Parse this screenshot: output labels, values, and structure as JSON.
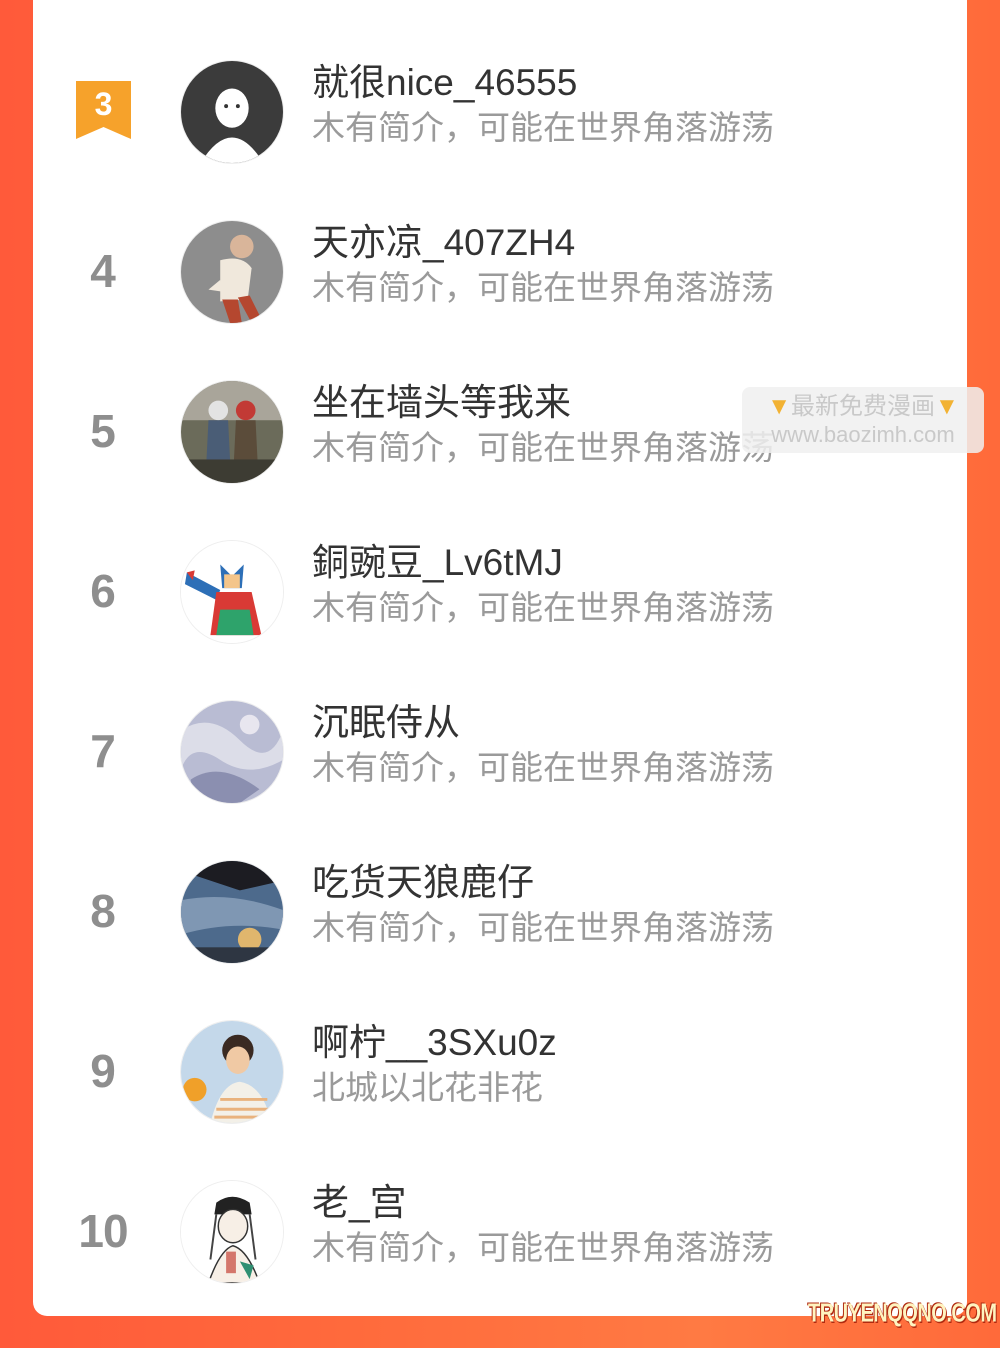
{
  "list": [
    {
      "rank": "3",
      "name": "就很nice_46555",
      "bio": "木有简介，可能在世界角落游荡",
      "badge": true
    },
    {
      "rank": "4",
      "name": "天亦凉_407ZH4",
      "bio": "木有简介，可能在世界角落游荡"
    },
    {
      "rank": "5",
      "name": "坐在墙头等我来",
      "bio": "木有简介，可能在世界角落游荡"
    },
    {
      "rank": "6",
      "name": "銅豌豆_Lv6tMJ",
      "bio": "木有简介，可能在世界角落游荡"
    },
    {
      "rank": "7",
      "name": "沉眠侍从",
      "bio": "木有简介，可能在世界角落游荡"
    },
    {
      "rank": "8",
      "name": "吃货天狼鹿仔",
      "bio": "木有简介，可能在世界角落游荡"
    },
    {
      "rank": "9",
      "name": "啊柠__3SXu0z",
      "bio": "北城以北花非花"
    },
    {
      "rank": "10",
      "name": "老_宫",
      "bio": "木有简介，可能在世界角落游荡"
    }
  ],
  "watermark": {
    "line1": "最新免费漫画",
    "line2": "www.baozimh.com"
  },
  "corner_logo": {
    "text": "TRUYENQQNO.COM"
  },
  "colors": {
    "background": "#ff6a3c",
    "badge": "#f6a22b",
    "rank": "#8e8e8e"
  }
}
